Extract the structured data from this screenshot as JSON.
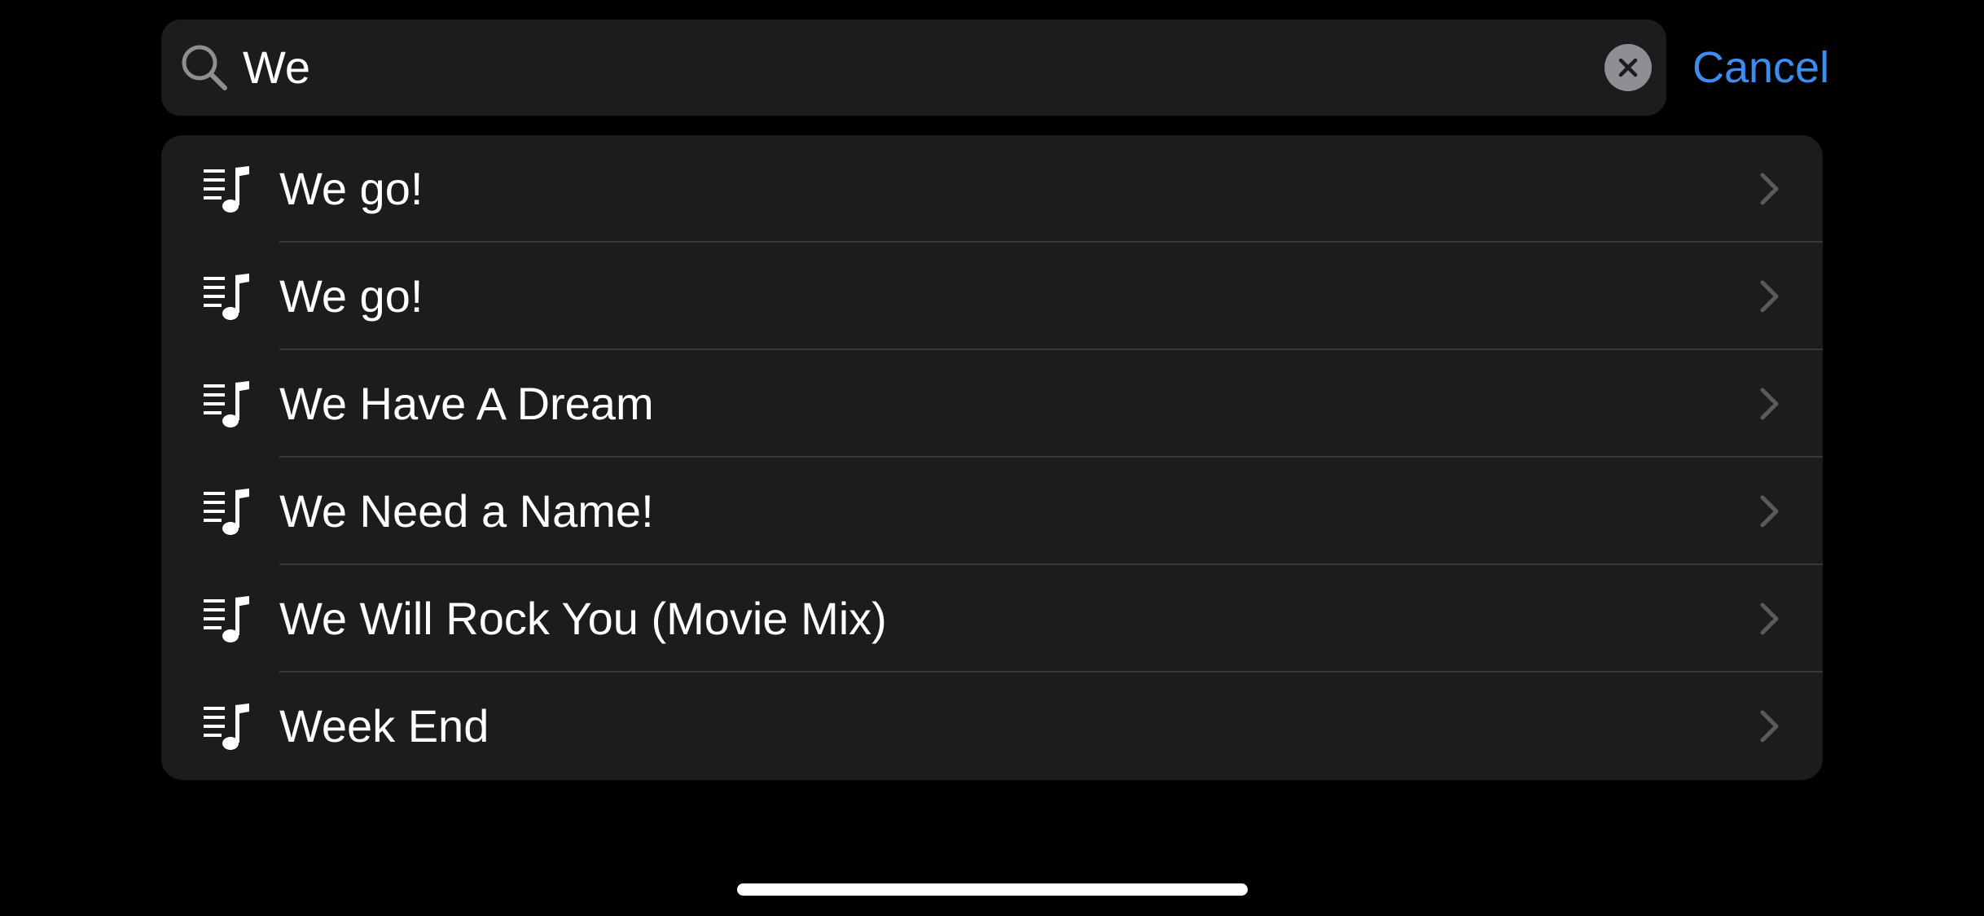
{
  "search": {
    "query": "We",
    "cancel_label": "Cancel",
    "icon": "search-icon",
    "clear_icon": "clear-icon"
  },
  "results": [
    {
      "title": "We go!",
      "icon": "playlist-music-icon"
    },
    {
      "title": "We go!",
      "icon": "playlist-music-icon"
    },
    {
      "title": "We Have A Dream",
      "icon": "playlist-music-icon"
    },
    {
      "title": "We Need a Name!",
      "icon": "playlist-music-icon"
    },
    {
      "title": "We Will Rock You (Movie Mix)",
      "icon": "playlist-music-icon"
    },
    {
      "title": "Week End",
      "icon": "playlist-music-icon"
    }
  ],
  "colors": {
    "background": "#000000",
    "surface": "#1c1c1e",
    "accent": "#3f8cf0",
    "chevron": "#5a5a5e",
    "divider": "#38383a"
  }
}
